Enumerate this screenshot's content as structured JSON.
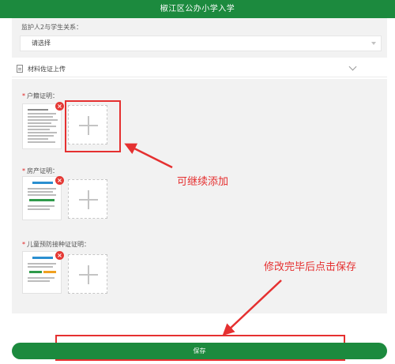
{
  "header": {
    "title": "椒江区公办小学入学"
  },
  "guardian": {
    "label": "监护人2与学生关系：",
    "select_value": "请选择"
  },
  "materials": {
    "title": "材料佐证上传"
  },
  "uploads": [
    {
      "label": "户籍证明：",
      "required": "*"
    },
    {
      "label": "房产证明：",
      "required": "*"
    },
    {
      "label": "儿童预防接种证证明：",
      "required": "*"
    }
  ],
  "annotations": {
    "add_more": "可继续添加",
    "save_hint": "修改完毕后点击保存"
  },
  "footer": {
    "save_label": "保存"
  },
  "icons": {
    "delete": "close-icon",
    "add": "plus-icon",
    "section": "document-icon",
    "expand": "chevron-down-icon"
  },
  "colors": {
    "brand": "#1c8a3e",
    "annotation": "#e53030",
    "delete": "#e53935"
  }
}
